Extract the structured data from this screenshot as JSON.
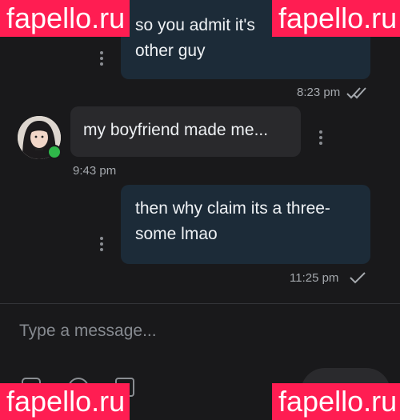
{
  "messages": [
    {
      "direction": "outgoing",
      "text_line1": "so you admit it's",
      "text_line2": "other guy",
      "time": "8:23 pm",
      "status": "read"
    },
    {
      "direction": "incoming",
      "text": "my boyfriend made me...",
      "time": "9:43 pm"
    },
    {
      "direction": "outgoing",
      "text_line1": "then why claim its a three-",
      "text_line2": "some lmao",
      "time": "11:25 pm",
      "status": "delivered"
    }
  ],
  "composer": {
    "placeholder": "Type a message..."
  },
  "watermark": {
    "text": "fapello.ru",
    "color": "#ff1d52"
  },
  "colors": {
    "background": "#19191b",
    "outgoing_bubble": "#1c2b38",
    "incoming_bubble": "#29292c",
    "online": "#2fb84a"
  }
}
